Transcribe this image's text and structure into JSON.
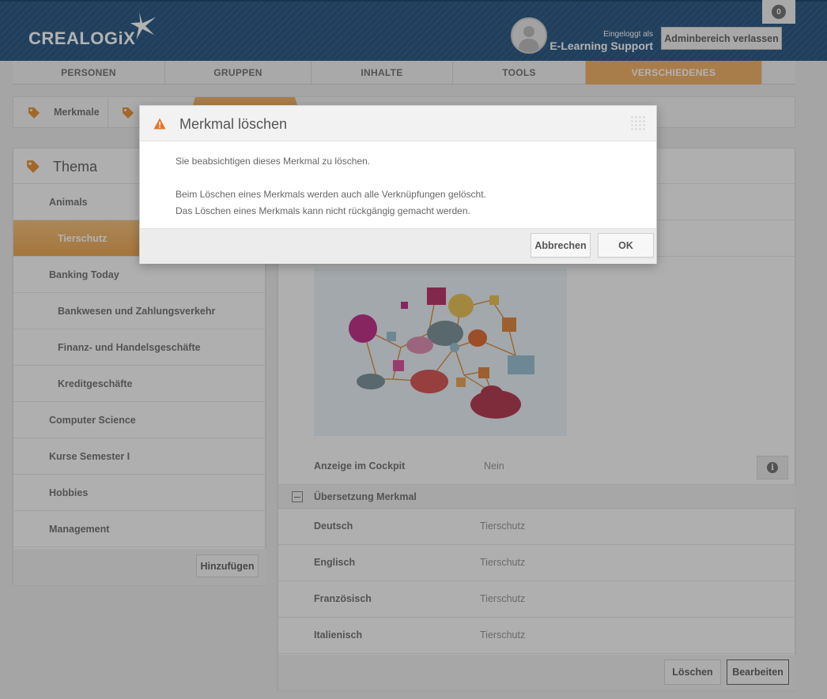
{
  "header": {
    "logo_text": "CREALOGiX",
    "login_label": "Eingeloggt als",
    "login_name": "E-Learning Support",
    "admin_button": "Adminbereich verlassen"
  },
  "nav": {
    "items": [
      {
        "label": "PERSONEN"
      },
      {
        "label": "GRUPPEN"
      },
      {
        "label": "INHALTE"
      },
      {
        "label": "TOOLS"
      },
      {
        "label": "VERSCHIEDENES",
        "active": true
      }
    ],
    "badge": "0"
  },
  "breadcrumb": {
    "items": [
      {
        "label": "Merkmale"
      }
    ]
  },
  "left_panel": {
    "title": "Thema",
    "items": [
      {
        "label": "Animals"
      },
      {
        "label": "Tierschutz",
        "active": true
      },
      {
        "label": "Banking Today"
      },
      {
        "label": "Bankwesen und Zahlungsverkehr"
      },
      {
        "label": "Finanz- und Handelsgeschäfte"
      },
      {
        "label": "Kreditgeschäfte"
      },
      {
        "label": "Computer Science"
      },
      {
        "label": "Kurse Semester I"
      },
      {
        "label": "Hobbies"
      },
      {
        "label": "Management"
      }
    ],
    "add_button": "Hinzufügen"
  },
  "right_panel": {
    "cockpit_label": "Anzeige im Cockpit",
    "cockpit_value": "Nein",
    "translation_section": "Übersetzung Merkmal",
    "translations": [
      {
        "language": "Deutsch",
        "value": "Tierschutz"
      },
      {
        "language": "Englisch",
        "value": "Tierschutz"
      },
      {
        "language": "Französisch",
        "value": "Tierschutz"
      },
      {
        "language": "Italienisch",
        "value": "Tierschutz"
      }
    ],
    "delete_button": "Löschen",
    "edit_button": "Bearbeiten"
  },
  "dialog": {
    "title": "Merkmal löschen",
    "line1": "Sie beabsichtigen dieses Merkmal zu löschen.",
    "line2": "Beim Löschen eines Merkmals werden auch alle Verknüpfungen gelöscht.",
    "line3": "Das Löschen eines Merkmals kann nicht rückgängig gemacht werden.",
    "cancel_button": "Abbrechen",
    "ok_button": "OK"
  },
  "colors": {
    "header_blue": "#2e5b86",
    "accent_orange": "#f2b46a",
    "warning_orange": "#e8742c"
  }
}
